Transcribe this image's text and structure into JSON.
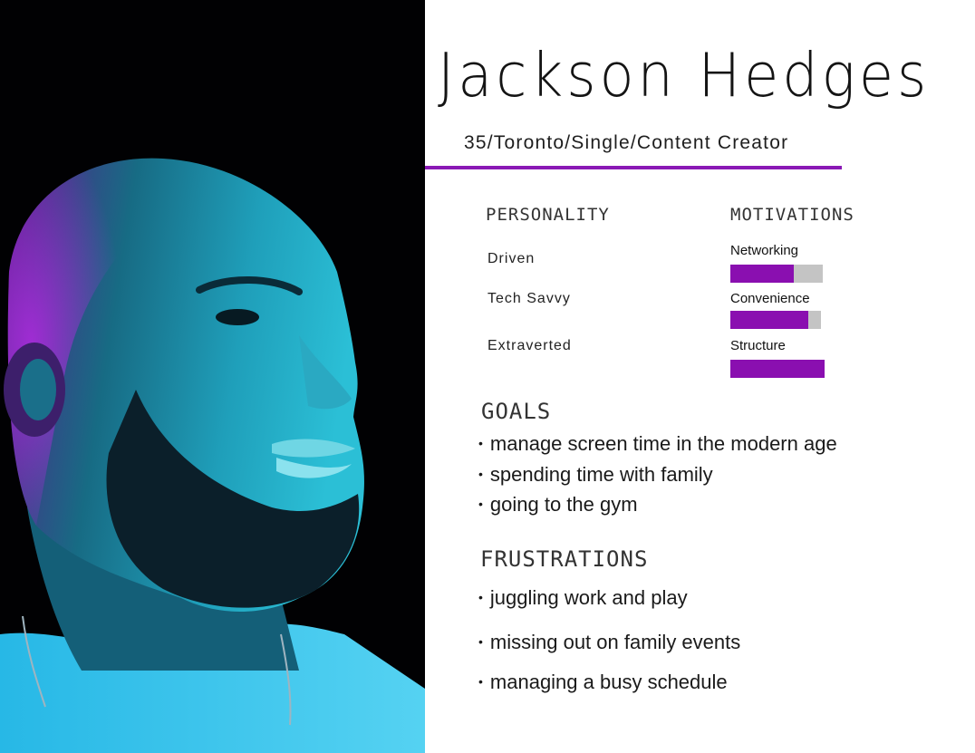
{
  "profile": {
    "name": "Jackson Hedges",
    "subtitle": "35/Toronto/Single/Content Creator"
  },
  "personality": {
    "heading": "PERSONALITY",
    "traits": [
      "Driven",
      "Tech Savvy",
      "Extraverted"
    ]
  },
  "motivations": {
    "heading": "MOTIVATIONS",
    "items": [
      {
        "label": "Networking",
        "level": 0.69
      },
      {
        "label": "Convenience",
        "level": 0.86
      },
      {
        "label": "Structure",
        "level": 1.0
      }
    ]
  },
  "goals": {
    "heading": "GOALS",
    "items": [
      "manage screen time in the modern age",
      "spending time with family",
      "going to the gym"
    ]
  },
  "frustrations": {
    "heading": "FRUSTRATIONS",
    "items": [
      "juggling work and play",
      "missing out on family events",
      "managing a busy schedule"
    ]
  },
  "colors": {
    "accent": "#8a18b5",
    "bar_fill": "#8a0fb0",
    "bar_track": "#c4c4c4",
    "photo_bg": "#010103",
    "rim_purple": "#9a1fd6",
    "face_teal": "#1b9db5"
  }
}
